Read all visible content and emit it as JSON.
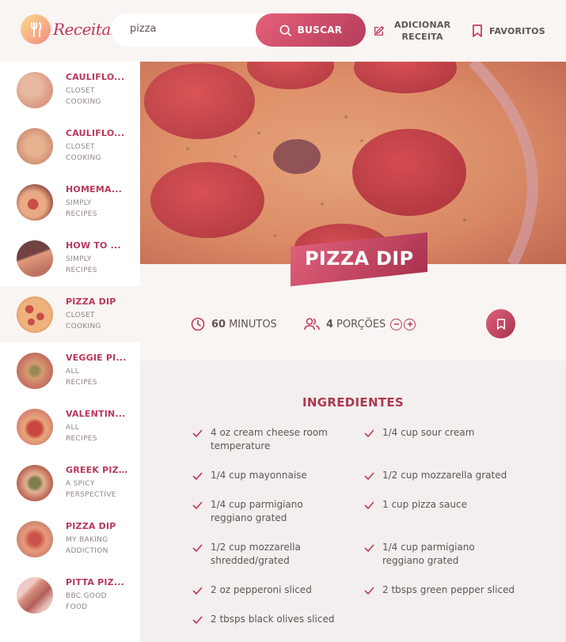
{
  "app": {
    "name": "Receitas"
  },
  "search": {
    "value": "pizza",
    "button_label": "BUSCAR"
  },
  "nav": {
    "add_recipe": "ADICIONAR RECEITA",
    "add_recipe_line1": "ADICIONAR",
    "add_recipe_line2": "RECEITA",
    "favorites": "FAVORITOS"
  },
  "results": [
    {
      "title": "CAULIFLO...",
      "publisher_line1": "CLOSET",
      "publisher_line2": "COOKING"
    },
    {
      "title": "CAULIFLO...",
      "publisher_line1": "CLOSET",
      "publisher_line2": "COOKING"
    },
    {
      "title": "HOMEMA...",
      "publisher_line1": "SIMPLY",
      "publisher_line2": "RECIPES"
    },
    {
      "title": "HOW TO ...",
      "publisher_line1": "SIMPLY",
      "publisher_line2": "RECIPES"
    },
    {
      "title": "PIZZA DIP",
      "publisher_line1": "CLOSET",
      "publisher_line2": "COOKING"
    },
    {
      "title": "VEGGIE PI...",
      "publisher_line1": "ALL",
      "publisher_line2": "RECIPES"
    },
    {
      "title": "VALENTIN...",
      "publisher_line1": "ALL",
      "publisher_line2": "RECIPES"
    },
    {
      "title": "GREEK PIZZA",
      "publisher_line1": "A SPICY",
      "publisher_line2": "PERSPECTIVE"
    },
    {
      "title": "PIZZA DIP",
      "publisher_line1": "MY BAKING",
      "publisher_line2": "ADDICTION"
    },
    {
      "title": "PITTA PIZ...",
      "publisher_line1": "BBC GOOD",
      "publisher_line2": "FOOD"
    }
  ],
  "recipe": {
    "title": "PIZZA DIP",
    "minutes": "60",
    "minutes_label": "MINUTOS",
    "servings": "4",
    "servings_label": "PORÇÕES"
  },
  "ingredients": {
    "heading": "INGREDIENTES",
    "items": [
      "4 oz cream cheese room temperature",
      "1/4 cup sour cream",
      "1/4 cup mayonnaise",
      "1/2 cup mozzarella grated",
      "1/4 cup parmigiano reggiano grated",
      "1 cup pizza sauce",
      "1/2 cup mozzarella shredded/grated",
      "1/4 cup parmigiano reggiano grated",
      "2 oz pepperoni sliced",
      "2 tbsps green pepper sliced",
      "2 tbsps black olives sliced"
    ]
  },
  "colors": {
    "accent": "#c0385a",
    "accent_light": "#e0607a",
    "background": "#f9f5f3"
  }
}
